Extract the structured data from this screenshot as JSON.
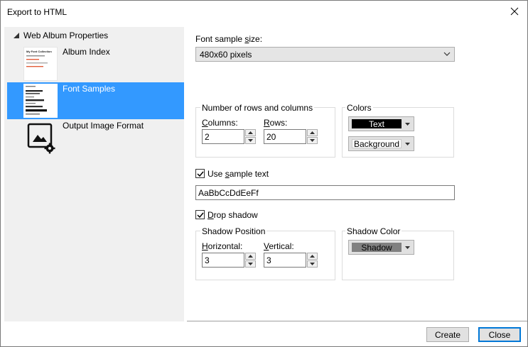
{
  "window": {
    "title": "Export to HTML"
  },
  "tree": {
    "root_label": "Web Album Properties",
    "items": [
      {
        "label": "Album Index",
        "icon": "album-index-thumbnail",
        "selected": false
      },
      {
        "label": "Font Samples",
        "icon": "font-samples-thumbnail",
        "selected": true
      },
      {
        "label": "Output Image Format",
        "icon": "image-settings-icon",
        "selected": false
      }
    ],
    "album_thumb_title": "My Font Collection"
  },
  "font_sample_size": {
    "label": "Font sample size:",
    "value": "480x60 pixels"
  },
  "rows_columns": {
    "group_label": "Number of rows and columns",
    "columns_label": "Columns:",
    "columns_value": "2",
    "rows_label": "Rows:",
    "rows_value": "20"
  },
  "colors": {
    "group_label": "Colors",
    "text_label": "Text",
    "text_color": "#000000",
    "background_label": "Background",
    "background_color": "#ffffff"
  },
  "sample_text": {
    "checkbox_label": "Use sample text",
    "checked": true,
    "value": "AaBbCcDdEeFf"
  },
  "drop_shadow": {
    "checkbox_label": "Drop shadow",
    "checked": true
  },
  "shadow_position": {
    "group_label": "Shadow Position",
    "horizontal_label": "Horizontal:",
    "horizontal_value": "3",
    "vertical_label": "Vertical:",
    "vertical_value": "3"
  },
  "shadow_color": {
    "group_label": "Shadow Color",
    "label": "Shadow",
    "color": "#808080"
  },
  "buttons": {
    "create": "Create",
    "close": "Close"
  }
}
